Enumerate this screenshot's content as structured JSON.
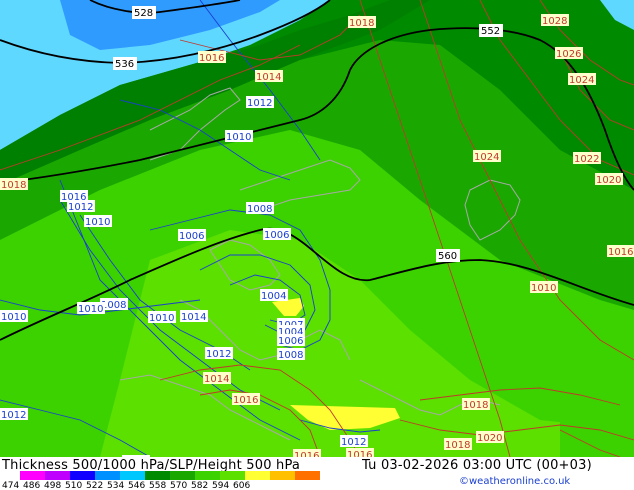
{
  "map": {
    "colors": {
      "sea_light": "#5fd8ff",
      "sea_blue": "#2f9bff",
      "green_dark": "#008a00",
      "green_mid": "#1aa800",
      "green_bright": "#3cd200",
      "green_light": "#5be000",
      "yellow": "#ffff33",
      "height_line": "#000000",
      "isobar_low": "#1a3fd0",
      "isobar_high": "#c0392b",
      "coast": "#a8a8a8"
    },
    "height_labels": [
      "528",
      "536",
      "552",
      "560"
    ],
    "isobar_labels": [
      "1028",
      "1018",
      "1016",
      "1014",
      "1012",
      "1010",
      "1026",
      "1024",
      "1024",
      "1022",
      "1020",
      "1018",
      "1016",
      "1012",
      "1010",
      "1008",
      "1006",
      "1006",
      "1010",
      "1004",
      "1007",
      "1004",
      "1006",
      "1008",
      "1010",
      "1008",
      "1010",
      "1012",
      "1014",
      "1016",
      "1018",
      "1020",
      "1018",
      "1016",
      "1016",
      "1012",
      "1012",
      "1016",
      "1014",
      "1010",
      "1012"
    ]
  },
  "footer": {
    "title": "Thickness 500/1000 hPa/SLP/Height 500 hPa",
    "datetime": "Tu 03-02-2026 03:00 UTC (00+03)",
    "credit": "©weatheronline.co.uk",
    "scale_ticks": [
      "474",
      "486",
      "498",
      "510",
      "522",
      "534",
      "546",
      "558",
      "570",
      "582",
      "594",
      "606"
    ],
    "scale_colors": [
      "#ff00ff",
      "#c000ff",
      "#1000ff",
      "#0090ff",
      "#00c8ff",
      "#008a00",
      "#1aa800",
      "#3cd200",
      "#5be000",
      "#ffff33",
      "#ffc000",
      "#ff7000"
    ]
  }
}
